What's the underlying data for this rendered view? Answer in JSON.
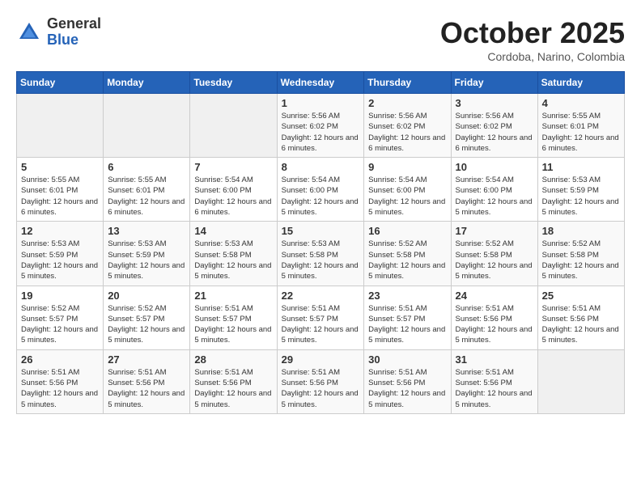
{
  "header": {
    "logo": {
      "general": "General",
      "blue": "Blue"
    },
    "title": "October 2025",
    "subtitle": "Cordoba, Narino, Colombia"
  },
  "weekdays": [
    "Sunday",
    "Monday",
    "Tuesday",
    "Wednesday",
    "Thursday",
    "Friday",
    "Saturday"
  ],
  "weeks": [
    [
      {
        "day": "",
        "info": ""
      },
      {
        "day": "",
        "info": ""
      },
      {
        "day": "",
        "info": ""
      },
      {
        "day": "1",
        "info": "Sunrise: 5:56 AM\nSunset: 6:02 PM\nDaylight: 12 hours and 6 minutes."
      },
      {
        "day": "2",
        "info": "Sunrise: 5:56 AM\nSunset: 6:02 PM\nDaylight: 12 hours and 6 minutes."
      },
      {
        "day": "3",
        "info": "Sunrise: 5:56 AM\nSunset: 6:02 PM\nDaylight: 12 hours and 6 minutes."
      },
      {
        "day": "4",
        "info": "Sunrise: 5:55 AM\nSunset: 6:01 PM\nDaylight: 12 hours and 6 minutes."
      }
    ],
    [
      {
        "day": "5",
        "info": "Sunrise: 5:55 AM\nSunset: 6:01 PM\nDaylight: 12 hours and 6 minutes."
      },
      {
        "day": "6",
        "info": "Sunrise: 5:55 AM\nSunset: 6:01 PM\nDaylight: 12 hours and 6 minutes."
      },
      {
        "day": "7",
        "info": "Sunrise: 5:54 AM\nSunset: 6:00 PM\nDaylight: 12 hours and 6 minutes."
      },
      {
        "day": "8",
        "info": "Sunrise: 5:54 AM\nSunset: 6:00 PM\nDaylight: 12 hours and 5 minutes."
      },
      {
        "day": "9",
        "info": "Sunrise: 5:54 AM\nSunset: 6:00 PM\nDaylight: 12 hours and 5 minutes."
      },
      {
        "day": "10",
        "info": "Sunrise: 5:54 AM\nSunset: 6:00 PM\nDaylight: 12 hours and 5 minutes."
      },
      {
        "day": "11",
        "info": "Sunrise: 5:53 AM\nSunset: 5:59 PM\nDaylight: 12 hours and 5 minutes."
      }
    ],
    [
      {
        "day": "12",
        "info": "Sunrise: 5:53 AM\nSunset: 5:59 PM\nDaylight: 12 hours and 5 minutes."
      },
      {
        "day": "13",
        "info": "Sunrise: 5:53 AM\nSunset: 5:59 PM\nDaylight: 12 hours and 5 minutes."
      },
      {
        "day": "14",
        "info": "Sunrise: 5:53 AM\nSunset: 5:58 PM\nDaylight: 12 hours and 5 minutes."
      },
      {
        "day": "15",
        "info": "Sunrise: 5:53 AM\nSunset: 5:58 PM\nDaylight: 12 hours and 5 minutes."
      },
      {
        "day": "16",
        "info": "Sunrise: 5:52 AM\nSunset: 5:58 PM\nDaylight: 12 hours and 5 minutes."
      },
      {
        "day": "17",
        "info": "Sunrise: 5:52 AM\nSunset: 5:58 PM\nDaylight: 12 hours and 5 minutes."
      },
      {
        "day": "18",
        "info": "Sunrise: 5:52 AM\nSunset: 5:58 PM\nDaylight: 12 hours and 5 minutes."
      }
    ],
    [
      {
        "day": "19",
        "info": "Sunrise: 5:52 AM\nSunset: 5:57 PM\nDaylight: 12 hours and 5 minutes."
      },
      {
        "day": "20",
        "info": "Sunrise: 5:52 AM\nSunset: 5:57 PM\nDaylight: 12 hours and 5 minutes."
      },
      {
        "day": "21",
        "info": "Sunrise: 5:51 AM\nSunset: 5:57 PM\nDaylight: 12 hours and 5 minutes."
      },
      {
        "day": "22",
        "info": "Sunrise: 5:51 AM\nSunset: 5:57 PM\nDaylight: 12 hours and 5 minutes."
      },
      {
        "day": "23",
        "info": "Sunrise: 5:51 AM\nSunset: 5:57 PM\nDaylight: 12 hours and 5 minutes."
      },
      {
        "day": "24",
        "info": "Sunrise: 5:51 AM\nSunset: 5:56 PM\nDaylight: 12 hours and 5 minutes."
      },
      {
        "day": "25",
        "info": "Sunrise: 5:51 AM\nSunset: 5:56 PM\nDaylight: 12 hours and 5 minutes."
      }
    ],
    [
      {
        "day": "26",
        "info": "Sunrise: 5:51 AM\nSunset: 5:56 PM\nDaylight: 12 hours and 5 minutes."
      },
      {
        "day": "27",
        "info": "Sunrise: 5:51 AM\nSunset: 5:56 PM\nDaylight: 12 hours and 5 minutes."
      },
      {
        "day": "28",
        "info": "Sunrise: 5:51 AM\nSunset: 5:56 PM\nDaylight: 12 hours and 5 minutes."
      },
      {
        "day": "29",
        "info": "Sunrise: 5:51 AM\nSunset: 5:56 PM\nDaylight: 12 hours and 5 minutes."
      },
      {
        "day": "30",
        "info": "Sunrise: 5:51 AM\nSunset: 5:56 PM\nDaylight: 12 hours and 5 minutes."
      },
      {
        "day": "31",
        "info": "Sunrise: 5:51 AM\nSunset: 5:56 PM\nDaylight: 12 hours and 5 minutes."
      },
      {
        "day": "",
        "info": ""
      }
    ]
  ]
}
